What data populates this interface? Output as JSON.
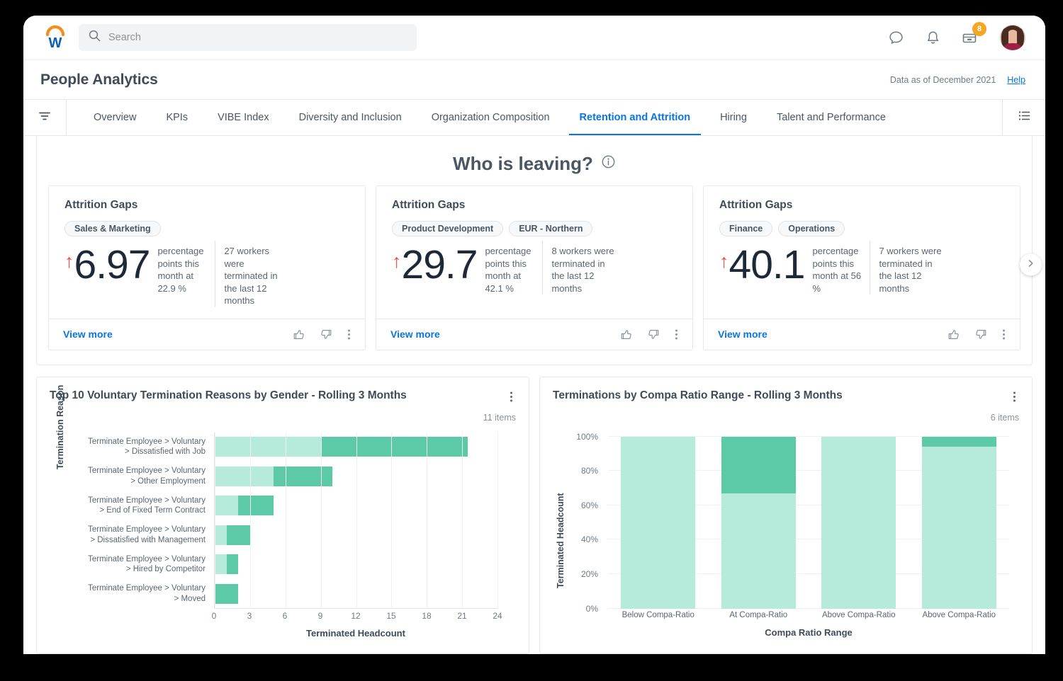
{
  "topbar": {
    "logo_name": "workday-logo",
    "search": {
      "placeholder": "Search",
      "value": ""
    },
    "icons": [
      {
        "name": "chat-icon"
      },
      {
        "name": "bell-icon"
      },
      {
        "name": "inbox-icon",
        "badge": "8"
      }
    ],
    "avatar_label": "user-avatar"
  },
  "header": {
    "title": "People Analytics",
    "data_as_of": "Data as of December 2021",
    "help_label": "Help"
  },
  "tabs": [
    {
      "label": "Overview",
      "active": false
    },
    {
      "label": "KPIs",
      "active": false
    },
    {
      "label": "VIBE Index",
      "active": false
    },
    {
      "label": "Diversity and Inclusion",
      "active": false
    },
    {
      "label": "Organization Composition",
      "active": false
    },
    {
      "label": "Retention and Attrition",
      "active": true
    },
    {
      "label": "Hiring",
      "active": false
    },
    {
      "label": "Talent and Performance",
      "active": false
    }
  ],
  "section": {
    "title": "Who is leaving?",
    "info_icon": "info-icon"
  },
  "attrition_cards": [
    {
      "title": "Attrition Gaps",
      "pills": [
        "Sales & Marketing"
      ],
      "trend": "↑",
      "value": "6.97",
      "desc_left": "percentage points this month at 22.9 %",
      "desc_right": "27 workers were terminated in the last 12 months",
      "view_more": "View more"
    },
    {
      "title": "Attrition Gaps",
      "pills": [
        "Product Development",
        "EUR - Northern"
      ],
      "trend": "↑",
      "value": "29.7",
      "desc_left": "percentage points this month at 42.1 %",
      "desc_right": "8 workers were terminated in the last 12 months",
      "view_more": "View more"
    },
    {
      "title": "Attrition Gaps",
      "pills": [
        "Finance",
        "Operations"
      ],
      "trend": "↑",
      "value": "40.1",
      "desc_left": "percentage points this month at 56 %",
      "desc_right": "7 workers were terminated in the last 12 months",
      "view_more": "View more"
    }
  ],
  "colors": {
    "accent_blue": "#0875e1",
    "brand_orange": "#f5a623",
    "series_light": "#b6ebdc",
    "series_dark": "#5cc9a7",
    "trend_up_red": "#f04a3c"
  },
  "chart_data": [
    {
      "type": "bar",
      "orientation": "horizontal",
      "stacked": true,
      "title": "Top 10 Voluntary Termination Reasons by Gender - Rolling 3 Months",
      "items_count": "11 items",
      "xlabel": "Terminated Headcount",
      "ylabel": "Termination Reason",
      "xlim": [
        0,
        24
      ],
      "xticks": [
        "0",
        "3",
        "6",
        "9",
        "12",
        "15",
        "18",
        "21",
        "24"
      ],
      "grid": true,
      "categories": [
        "Terminate Employee > Voluntary > Dissatisfied with Job",
        "Terminate Employee > Voluntary > Other Employment",
        "Terminate Employee > Voluntary > End of Fixed Term Contract",
        "Terminate Employee > Voluntary > Dissatisfied with Management",
        "Terminate Employee > Voluntary > Hired by Competitor",
        "Terminate Employee > Voluntary > Moved"
      ],
      "series": [
        {
          "name": "light",
          "values": [
            9,
            5,
            2,
            1,
            1,
            0
          ]
        },
        {
          "name": "dark",
          "values": [
            12.5,
            5,
            3,
            2,
            1,
            2
          ]
        }
      ],
      "totals": [
        21.5,
        10,
        5,
        3,
        2,
        2
      ]
    },
    {
      "type": "bar",
      "orientation": "vertical",
      "stacked": true,
      "title": "Terminations by Compa Ratio Range - Rolling 3 Months",
      "items_count": "6 items",
      "xlabel": "Compa Ratio Range",
      "ylabel": "Terminated Headcount",
      "ylim": [
        0,
        100
      ],
      "yticks": [
        "0%",
        "20%",
        "40%",
        "60%",
        "80%",
        "100%"
      ],
      "grid": true,
      "categories": [
        "Below Compa-Ratio",
        "At Compa-Ratio",
        "Above Compa-Ratio",
        "Above Compa-Ratio"
      ],
      "series": [
        {
          "name": "light",
          "values": [
            100,
            67,
            100,
            94
          ]
        },
        {
          "name": "dark",
          "values": [
            0,
            33,
            0,
            6
          ]
        }
      ]
    }
  ]
}
